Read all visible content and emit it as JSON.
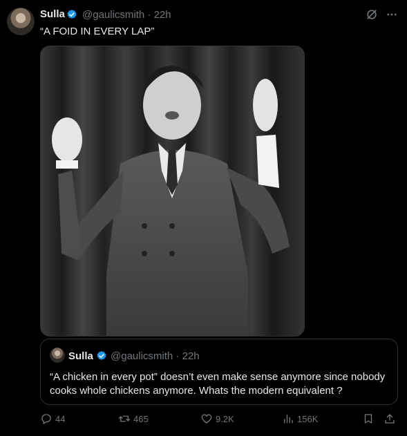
{
  "post": {
    "author_name": "Sulla",
    "handle": "@gaulicsmith",
    "separator": "·",
    "time": "22h",
    "text": "“A FOID IN EVERY LAP”"
  },
  "quote": {
    "author_name": "Sulla",
    "handle": "@gaulicsmith",
    "separator": "·",
    "time": "22h",
    "text": "“A chicken in every pot” doesn’t even make sense anymore since nobody cooks whole chickens anymore. Whats the modern equivalent ?"
  },
  "actions": {
    "replies": "44",
    "reposts": "465",
    "likes": "9.2K",
    "views": "156K"
  },
  "icons": [
    "verified-badge-icon",
    "grok-icon",
    "more-icon",
    "reply-icon",
    "repost-icon",
    "like-icon",
    "views-icon",
    "bookmark-icon",
    "share-icon"
  ],
  "colors": {
    "background": "#000000",
    "text": "#e7e9ea",
    "muted": "#71767b",
    "verified": "#1d9bf0",
    "border": "#2f3336"
  }
}
